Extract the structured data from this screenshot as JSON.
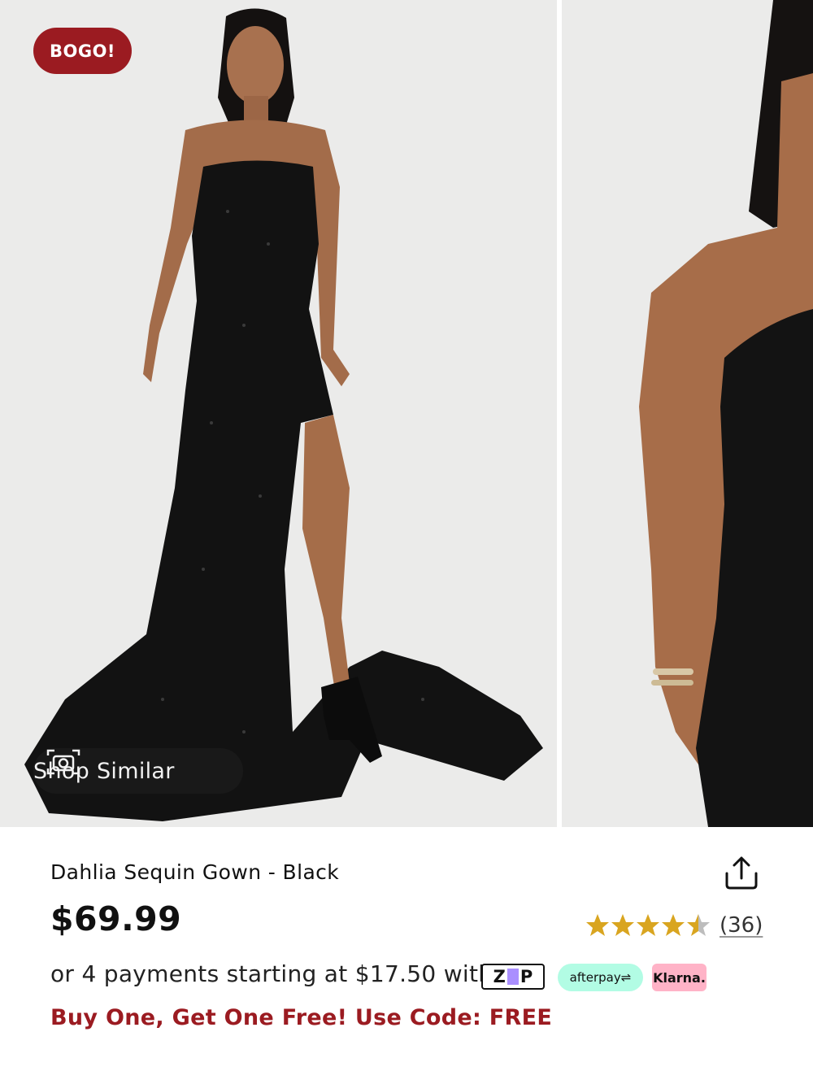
{
  "badge": {
    "label": "BOGO!"
  },
  "shop_similar": {
    "label": "Shop Similar"
  },
  "product": {
    "title": "Dahlia Sequin Gown - Black",
    "price": "$69.99",
    "rating": {
      "stars": 4.5,
      "max": 5,
      "reviews": "(36)"
    }
  },
  "payments": {
    "text": "or 4 payments starting at $17.50 with",
    "providers": {
      "zip": "Z",
      "zip_tail": "P",
      "afterpay": "afterpay⇌",
      "klarna": "Klarna."
    }
  },
  "promo": {
    "text": "Buy One, Get One Free! Use Code: FREE"
  },
  "colors": {
    "brand_red": "#9b1b21",
    "star_gold": "#d9a520",
    "afterpay_mint": "#b2fce4",
    "klarna_pink": "#ffb3c7"
  },
  "icons": {
    "share": "share-icon",
    "camera": "camera-icon",
    "star": "star-icon"
  }
}
